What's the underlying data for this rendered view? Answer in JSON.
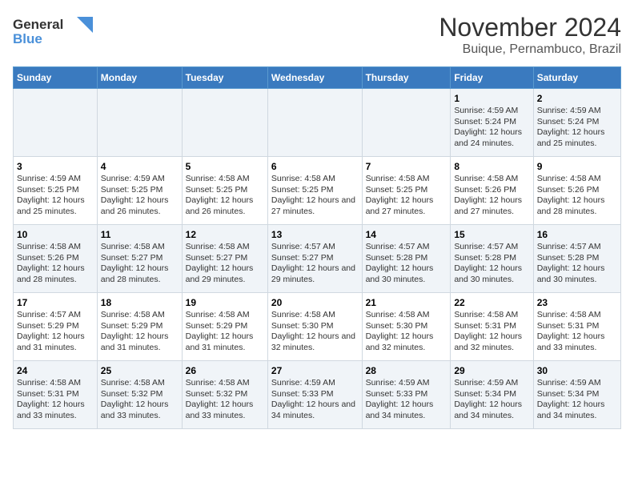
{
  "logo": {
    "line1": "General",
    "line2": "Blue"
  },
  "title": "November 2024",
  "subtitle": "Buique, Pernambuco, Brazil",
  "weekdays": [
    "Sunday",
    "Monday",
    "Tuesday",
    "Wednesday",
    "Thursday",
    "Friday",
    "Saturday"
  ],
  "weeks": [
    [
      {
        "day": "",
        "info": ""
      },
      {
        "day": "",
        "info": ""
      },
      {
        "day": "",
        "info": ""
      },
      {
        "day": "",
        "info": ""
      },
      {
        "day": "",
        "info": ""
      },
      {
        "day": "1",
        "info": "Sunrise: 4:59 AM\nSunset: 5:24 PM\nDaylight: 12 hours and 24 minutes."
      },
      {
        "day": "2",
        "info": "Sunrise: 4:59 AM\nSunset: 5:24 PM\nDaylight: 12 hours and 25 minutes."
      }
    ],
    [
      {
        "day": "3",
        "info": "Sunrise: 4:59 AM\nSunset: 5:25 PM\nDaylight: 12 hours and 25 minutes."
      },
      {
        "day": "4",
        "info": "Sunrise: 4:59 AM\nSunset: 5:25 PM\nDaylight: 12 hours and 26 minutes."
      },
      {
        "day": "5",
        "info": "Sunrise: 4:58 AM\nSunset: 5:25 PM\nDaylight: 12 hours and 26 minutes."
      },
      {
        "day": "6",
        "info": "Sunrise: 4:58 AM\nSunset: 5:25 PM\nDaylight: 12 hours and 27 minutes."
      },
      {
        "day": "7",
        "info": "Sunrise: 4:58 AM\nSunset: 5:25 PM\nDaylight: 12 hours and 27 minutes."
      },
      {
        "day": "8",
        "info": "Sunrise: 4:58 AM\nSunset: 5:26 PM\nDaylight: 12 hours and 27 minutes."
      },
      {
        "day": "9",
        "info": "Sunrise: 4:58 AM\nSunset: 5:26 PM\nDaylight: 12 hours and 28 minutes."
      }
    ],
    [
      {
        "day": "10",
        "info": "Sunrise: 4:58 AM\nSunset: 5:26 PM\nDaylight: 12 hours and 28 minutes."
      },
      {
        "day": "11",
        "info": "Sunrise: 4:58 AM\nSunset: 5:27 PM\nDaylight: 12 hours and 28 minutes."
      },
      {
        "day": "12",
        "info": "Sunrise: 4:58 AM\nSunset: 5:27 PM\nDaylight: 12 hours and 29 minutes."
      },
      {
        "day": "13",
        "info": "Sunrise: 4:57 AM\nSunset: 5:27 PM\nDaylight: 12 hours and 29 minutes."
      },
      {
        "day": "14",
        "info": "Sunrise: 4:57 AM\nSunset: 5:28 PM\nDaylight: 12 hours and 30 minutes."
      },
      {
        "day": "15",
        "info": "Sunrise: 4:57 AM\nSunset: 5:28 PM\nDaylight: 12 hours and 30 minutes."
      },
      {
        "day": "16",
        "info": "Sunrise: 4:57 AM\nSunset: 5:28 PM\nDaylight: 12 hours and 30 minutes."
      }
    ],
    [
      {
        "day": "17",
        "info": "Sunrise: 4:57 AM\nSunset: 5:29 PM\nDaylight: 12 hours and 31 minutes."
      },
      {
        "day": "18",
        "info": "Sunrise: 4:58 AM\nSunset: 5:29 PM\nDaylight: 12 hours and 31 minutes."
      },
      {
        "day": "19",
        "info": "Sunrise: 4:58 AM\nSunset: 5:29 PM\nDaylight: 12 hours and 31 minutes."
      },
      {
        "day": "20",
        "info": "Sunrise: 4:58 AM\nSunset: 5:30 PM\nDaylight: 12 hours and 32 minutes."
      },
      {
        "day": "21",
        "info": "Sunrise: 4:58 AM\nSunset: 5:30 PM\nDaylight: 12 hours and 32 minutes."
      },
      {
        "day": "22",
        "info": "Sunrise: 4:58 AM\nSunset: 5:31 PM\nDaylight: 12 hours and 32 minutes."
      },
      {
        "day": "23",
        "info": "Sunrise: 4:58 AM\nSunset: 5:31 PM\nDaylight: 12 hours and 33 minutes."
      }
    ],
    [
      {
        "day": "24",
        "info": "Sunrise: 4:58 AM\nSunset: 5:31 PM\nDaylight: 12 hours and 33 minutes."
      },
      {
        "day": "25",
        "info": "Sunrise: 4:58 AM\nSunset: 5:32 PM\nDaylight: 12 hours and 33 minutes."
      },
      {
        "day": "26",
        "info": "Sunrise: 4:58 AM\nSunset: 5:32 PM\nDaylight: 12 hours and 33 minutes."
      },
      {
        "day": "27",
        "info": "Sunrise: 4:59 AM\nSunset: 5:33 PM\nDaylight: 12 hours and 34 minutes."
      },
      {
        "day": "28",
        "info": "Sunrise: 4:59 AM\nSunset: 5:33 PM\nDaylight: 12 hours and 34 minutes."
      },
      {
        "day": "29",
        "info": "Sunrise: 4:59 AM\nSunset: 5:34 PM\nDaylight: 12 hours and 34 minutes."
      },
      {
        "day": "30",
        "info": "Sunrise: 4:59 AM\nSunset: 5:34 PM\nDaylight: 12 hours and 34 minutes."
      }
    ]
  ]
}
